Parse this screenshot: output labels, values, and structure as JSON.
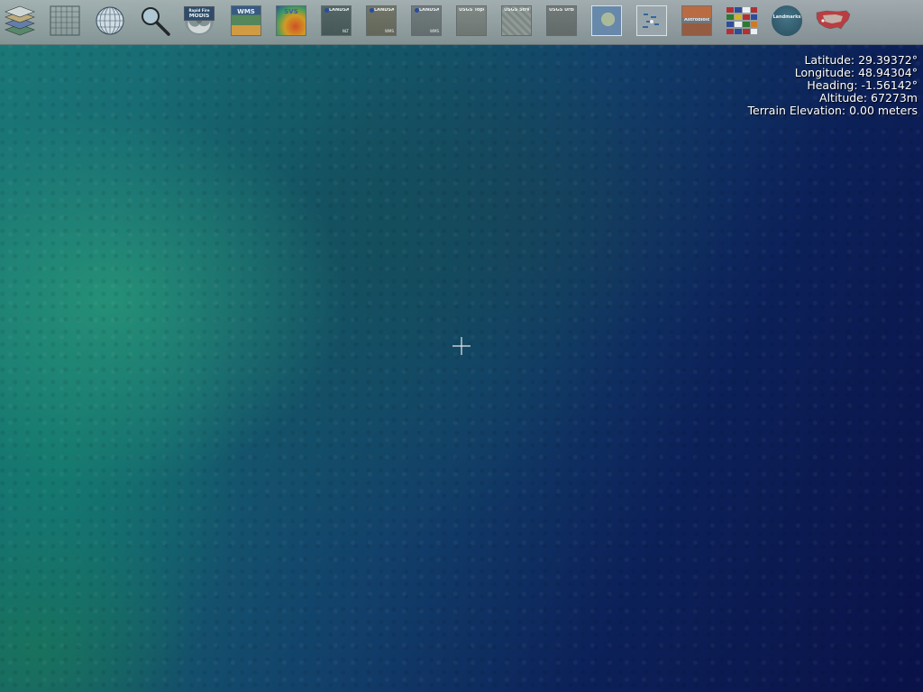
{
  "status": {
    "latitude": "Latitude: 29.39372°",
    "longitude": "Longitude: 48.94304°",
    "heading": "Heading: -1.56142°",
    "altitude": "Altitude: 67273m",
    "terrain_elevation": "Terrain Elevation: 0.00 meters"
  },
  "toolbar": {
    "tiles": {
      "modis": "MODIS",
      "modis_top": "Rapid Fire",
      "wms": "WMS",
      "svs": "SVS",
      "landsat_visible": "LANDSAT Visible",
      "landsat_visible_sub": "NLT",
      "landsat_visible2": "LANDSAT Visible",
      "landsat_visible2_sub": "WMS",
      "landsat_pseudo": "LANDSAT Pseudo",
      "landsat_pseudo_sub": "WMS",
      "usgs_topo": "USGS Topo Ortho",
      "usgs_street": "USGS Street Map",
      "usgs_urban": "USGS Urban Area",
      "astrobiology": "Astrobiology",
      "landmarks": "Landmarks"
    }
  },
  "colors": {
    "toolbar_bg": "#9aa3a3",
    "text": "#ffffff",
    "ocean_deep": "#0a1248",
    "ocean_shallow": "#1b7a78"
  },
  "icons": [
    "layer-manager-icon",
    "lat-lon-grid-icon",
    "globe-icon",
    "search-magnifier-icon",
    "hurricane-icon",
    "wms-icon",
    "svs-icon",
    "blue-marble-europe-icon",
    "place-names-icon",
    "flags-icon",
    "usa-map-icon",
    "crosshair-icon"
  ]
}
